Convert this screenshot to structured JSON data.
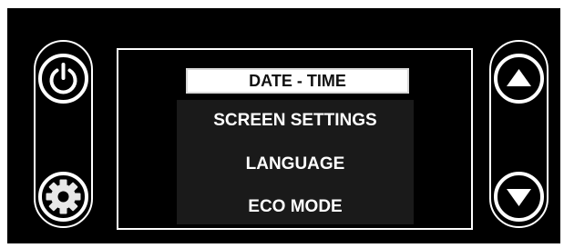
{
  "menu": {
    "selected": "DATE - TIME",
    "items": [
      "SCREEN SETTINGS",
      "LANGUAGE",
      "ECO MODE"
    ]
  },
  "controls": {
    "left": [
      "power-icon",
      "gear-icon"
    ],
    "right": [
      "arrow-up-icon",
      "arrow-down-icon"
    ]
  },
  "colors": {
    "panel": "#000000",
    "display_border": "#ffffff",
    "selected_bg": "#ffffff",
    "menu_bg": "#1a1a1a",
    "text": "#ffffff"
  }
}
